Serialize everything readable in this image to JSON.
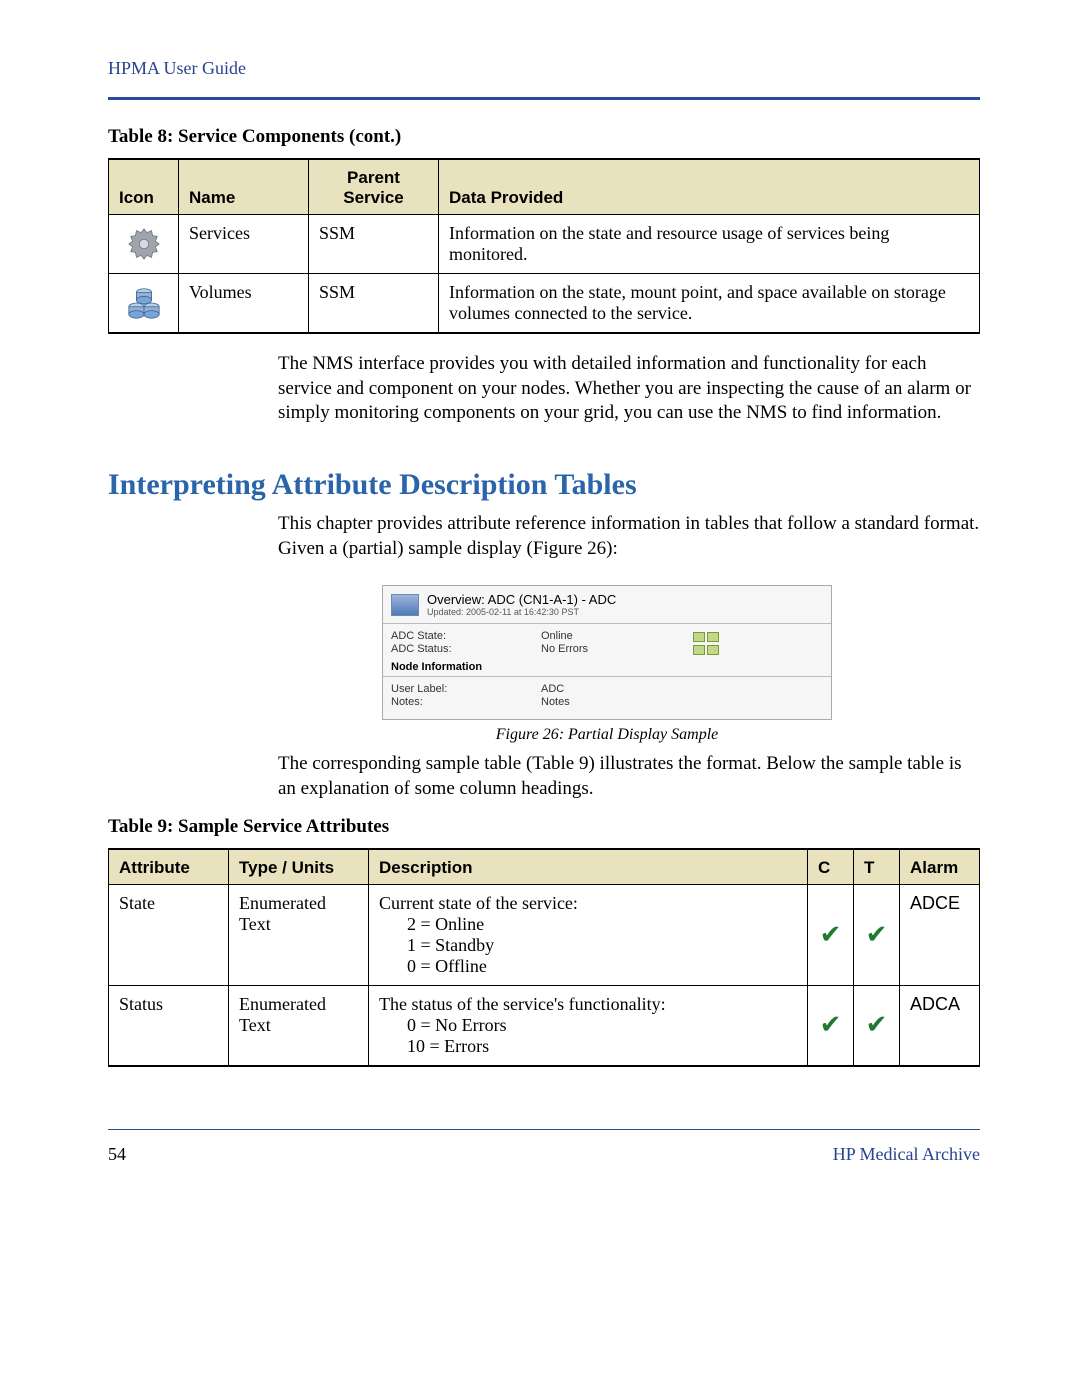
{
  "header": {
    "title": "HPMA User Guide"
  },
  "footer": {
    "page": "54",
    "right": "HP Medical Archive"
  },
  "table8": {
    "caption": "Table 8: Service Components (cont.)",
    "headers": {
      "icon": "Icon",
      "name": "Name",
      "parent": "Parent Service",
      "data": "Data Provided"
    },
    "rows": [
      {
        "name": "Services",
        "parent": "SSM",
        "data": "Information on the state and resource usage of services being monitored."
      },
      {
        "name": "Volumes",
        "parent": "SSM",
        "data": "Information on the state, mount point, and space available on storage volumes connected to the service."
      }
    ]
  },
  "para1": "The NMS interface provides you with detailed information and functionality for each service and component on your nodes. Whether you are inspecting the cause of an alarm or simply monitoring components on your grid, you can use the NMS to find information.",
  "section": {
    "heading": "Interpreting Attribute Description Tables"
  },
  "para2": "This chapter provides attribute reference information in tables that follow a standard format. Given a (partial) sample display (Figure 26):",
  "figure26": {
    "title": "Overview: ADC (CN1-A-1) - ADC",
    "subtitle": "Updated: 2005-02-11 at 16:42:30 PST",
    "rows1": [
      {
        "label": "ADC State:",
        "value": "Online"
      },
      {
        "label": "ADC Status:",
        "value": "No Errors"
      }
    ],
    "section": "Node Information",
    "rows2": [
      {
        "label": "User Label:",
        "value": "ADC"
      },
      {
        "label": "Notes:",
        "value": "Notes"
      }
    ],
    "caption": "Figure 26: Partial Display Sample"
  },
  "para3": "The corresponding sample table (Table 9) illustrates the format. Below the sample table is an explanation of some column headings.",
  "table9": {
    "caption": "Table 9: Sample Service Attributes",
    "headers": {
      "attr": "Attribute",
      "type": "Type / Units",
      "desc": "Description",
      "c": "C",
      "t": "T",
      "alarm": "Alarm"
    },
    "rows": [
      {
        "attr": "State",
        "type": "Enumerated Text",
        "desc_lead": "Current state of the service:",
        "desc_lines": [
          "2 = Online",
          "1 = Standby",
          "0 = Offline"
        ],
        "c": true,
        "t": true,
        "alarm": "ADCE"
      },
      {
        "attr": "Status",
        "type": "Enumerated Text",
        "desc_lead": "The status of the service's functionality:",
        "desc_lines": [
          "0 = No Errors",
          "10 = Errors"
        ],
        "c": true,
        "t": true,
        "alarm": "ADCA"
      }
    ]
  }
}
